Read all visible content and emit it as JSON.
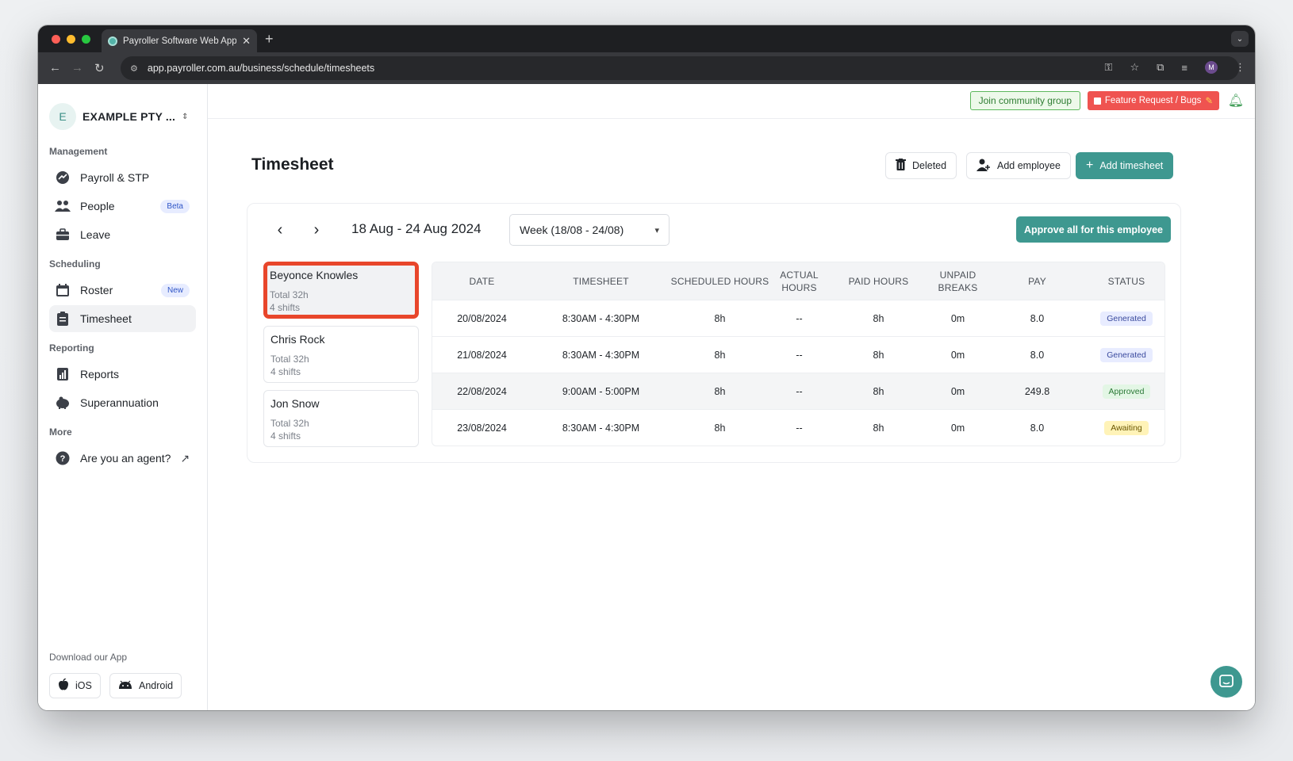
{
  "browser": {
    "tab_title": "Payroller Software Web Appli",
    "url": "app.payroller.com.au/business/schedule/timesheets",
    "profile_initial": "M"
  },
  "sidebar": {
    "org_initial": "E",
    "org_name": "EXAMPLE PTY ...",
    "sections": {
      "management": "Management",
      "scheduling": "Scheduling",
      "reporting": "Reporting",
      "more": "More"
    },
    "items": [
      {
        "label": "Payroll & STP",
        "icon": "payroll-icon"
      },
      {
        "label": "People",
        "icon": "people-icon",
        "badge": "Beta"
      },
      {
        "label": "Leave",
        "icon": "briefcase-icon"
      },
      {
        "label": "Roster",
        "icon": "calendar-icon",
        "badge": "New"
      },
      {
        "label": "Timesheet",
        "icon": "clipboard-icon",
        "active": true
      },
      {
        "label": "Reports",
        "icon": "chart-icon"
      },
      {
        "label": "Superannuation",
        "icon": "piggy-bank-icon"
      },
      {
        "label": "Are you an agent?",
        "icon": "question-icon"
      }
    ],
    "download_label": "Download our App",
    "ios_label": "iOS",
    "android_label": "Android"
  },
  "topbar": {
    "community_label": "Join community group",
    "feature_label": "Feature Request / Bugs"
  },
  "page": {
    "title": "Timesheet",
    "deleted_label": "Deleted",
    "add_employee_label": "Add employee",
    "add_timesheet_label": "Add timesheet",
    "date_range": "18 Aug - 24 Aug 2024",
    "week_select": "Week (18/08 - 24/08)",
    "approve_all_label": "Approve all for this employee"
  },
  "employees": [
    {
      "name": "Beyonce Knowles",
      "total": "Total 32h",
      "shifts": "4 shifts",
      "selected": true
    },
    {
      "name": "Chris Rock",
      "total": "Total 32h",
      "shifts": "4 shifts"
    },
    {
      "name": "Jon Snow",
      "total": "Total 32h",
      "shifts": "4 shifts"
    }
  ],
  "table": {
    "headers": [
      "DATE",
      "TIMESHEET",
      "SCHEDULED HOURS",
      "ACTUAL HOURS",
      "PAID HOURS",
      "UNPAID BREAKS",
      "PAY",
      "STATUS"
    ],
    "rows": [
      {
        "date": "20/08/2024",
        "timesheet": "8:30AM - 4:30PM",
        "scheduled": "8h",
        "actual": "--",
        "paid": "8h",
        "breaks": "0m",
        "pay": "8.0",
        "status": "Generated"
      },
      {
        "date": "21/08/2024",
        "timesheet": "8:30AM - 4:30PM",
        "scheduled": "8h",
        "actual": "--",
        "paid": "8h",
        "breaks": "0m",
        "pay": "8.0",
        "status": "Generated"
      },
      {
        "date": "22/08/2024",
        "timesheet": "9:00AM - 5:00PM",
        "scheduled": "8h",
        "actual": "--",
        "paid": "8h",
        "breaks": "0m",
        "pay": "249.8",
        "status": "Approved"
      },
      {
        "date": "23/08/2024",
        "timesheet": "8:30AM - 4:30PM",
        "scheduled": "8h",
        "actual": "--",
        "paid": "8h",
        "breaks": "0m",
        "pay": "8.0",
        "status": "Awaiting"
      }
    ]
  },
  "colors": {
    "accent": "#3e9890",
    "highlight_border": "#e8462b"
  }
}
